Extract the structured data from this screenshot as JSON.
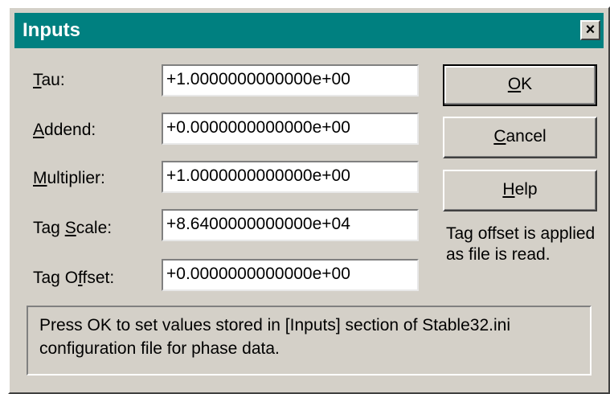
{
  "window": {
    "title": "Inputs",
    "close_glyph": "×"
  },
  "fields": [
    {
      "label_mnemonic": "T",
      "label_rest": "au:",
      "value": "+1.0000000000000e+00"
    },
    {
      "label_mnemonic": "A",
      "label_rest": "ddend:",
      "value": "+0.0000000000000e+00"
    },
    {
      "label_mnemonic": "M",
      "label_rest": "ultiplier:",
      "value": "+1.0000000000000e+00"
    },
    {
      "label_pre": "Tag ",
      "label_mnemonic": "S",
      "label_rest": "cale:",
      "value": "+8.6400000000000e+04"
    },
    {
      "label_pre": "Tag O",
      "label_mnemonic": "f",
      "label_rest": "fset:",
      "value": "+0.0000000000000e+00"
    }
  ],
  "buttons": {
    "ok": {
      "mnemonic": "O",
      "rest": "K"
    },
    "cancel": {
      "mnemonic": "C",
      "rest": "ancel"
    },
    "help": {
      "mnemonic": "H",
      "rest": "elp"
    }
  },
  "note": "Tag offset is applied as file is read.",
  "info": "Press OK to set values stored in [Inputs] section of Stable32.ini configuration file for phase data.",
  "colors": {
    "titlebar": "#008080",
    "dialog_bg": "#d4d0c8",
    "field_bg": "#ffffff"
  },
  "icons": {
    "close": "close-icon"
  }
}
